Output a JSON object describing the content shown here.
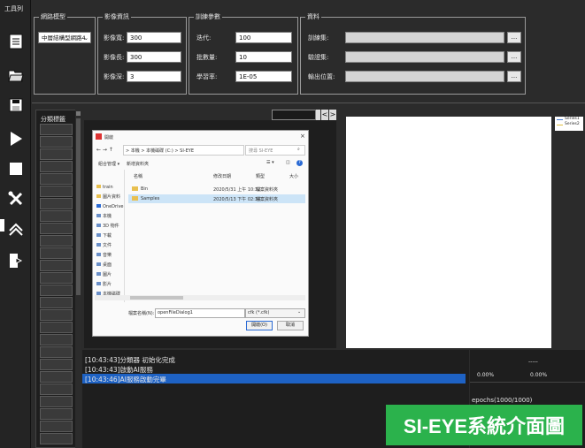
{
  "toolbar": {
    "title": "工具列",
    "buttons": [
      {
        "name": "document-icon"
      },
      {
        "name": "folder-open-icon"
      },
      {
        "name": "save-icon"
      },
      {
        "name": "play-icon"
      },
      {
        "name": "stop-icon"
      },
      {
        "name": "tools-icon"
      },
      {
        "name": "home-icon"
      },
      {
        "name": "exit-icon"
      }
    ]
  },
  "network_model": {
    "title": "網路模型",
    "selected": "中層結構型網路4"
  },
  "image_info": {
    "title": "影像資訊",
    "width_label": "影像寬:",
    "width_value": "300",
    "height_label": "影像長:",
    "height_value": "300",
    "depth_label": "影像深:",
    "depth_value": "3"
  },
  "training_params": {
    "title": "訓練參數",
    "iterations_label": "迭代:",
    "iterations_value": "100",
    "batch_label": "批數量:",
    "batch_value": "10",
    "lr_label": "學習率:",
    "lr_value": "1E-05"
  },
  "data": {
    "title": "資料",
    "train_label": "訓練集:",
    "val_label": "驗證集:",
    "output_label": "輸出位置:",
    "browse_label": "..."
  },
  "classify_panel": {
    "title": "分類標籤"
  },
  "image_nav": {
    "prev_label": "<",
    "next_label": ">"
  },
  "legend": {
    "series": [
      {
        "name": "Series1",
        "color": "#4a7fd4"
      },
      {
        "name": "Series2",
        "color": "#e0c040"
      }
    ]
  },
  "dialog": {
    "title": "開啟",
    "path": "> 本機 > 本機磁碟 (C:) > SI-EYE",
    "search_placeholder": "搜尋 SI-EYE",
    "organize_label": "組合管理 ▾",
    "new_folder_label": "新增資料夾",
    "col_name": "名稱",
    "col_date": "修改日期",
    "col_type": "類型",
    "col_size": "大小",
    "nav_items": [
      "train",
      "圖片資料",
      "OneDrive",
      "本機",
      "3D 物件",
      "下載",
      "文件",
      "音樂",
      "桌面",
      "圖片",
      "影片",
      "本機磁碟"
    ],
    "files": [
      {
        "name": "Bin",
        "date": "2020/5/31 上午 10:32",
        "type": "檔案資料夾"
      },
      {
        "name": "Samples",
        "date": "2020/5/13 下午 02:34",
        "type": "檔案資料夾"
      }
    ],
    "filename_label": "檔案名稱(N):",
    "filename_value": "openFileDialog1",
    "filter_value": "cfk (*.cfk)",
    "open_label": "開啟(O)",
    "cancel_label": "取消"
  },
  "log": {
    "lines": [
      "[10:43:43]分類器 初始化完成",
      "[10:43:43]啟動AI服務",
      "[10:43:46]AI服務啟動完畢"
    ]
  },
  "progress": {
    "dashes": "-----",
    "left_percent": "0.00%",
    "right_percent": "0.00%",
    "epochs": "epochs(1000/1000)"
  },
  "watermark": {
    "text": "SI-EYE系統介面圖"
  }
}
